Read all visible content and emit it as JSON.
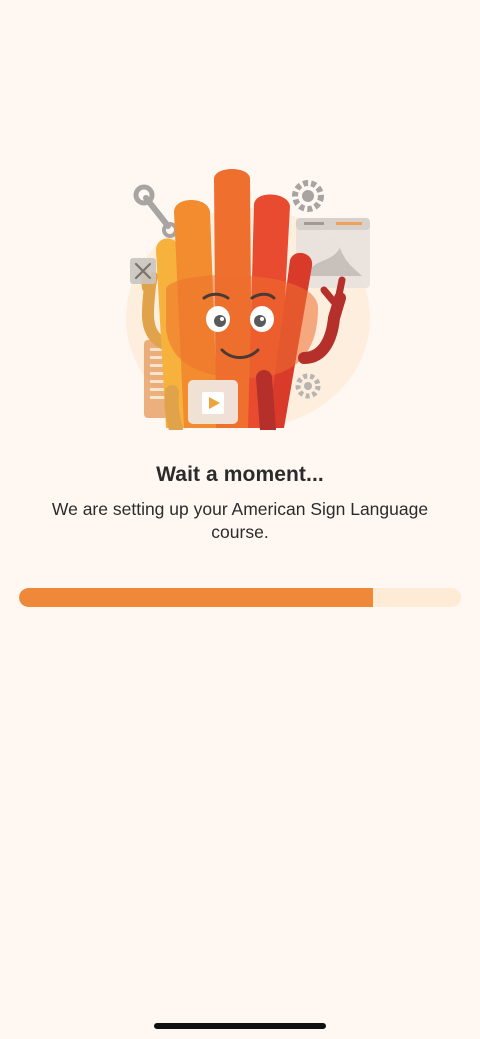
{
  "loading": {
    "title": "Wait a moment...",
    "message": "We are setting up your American Sign Language course.",
    "progress": 0.8
  },
  "colors": {
    "background": "#fff8f2",
    "progress_fill": "#f0883a",
    "progress_track": "#fdebd5",
    "text": "#2b2b2b"
  },
  "icons": [
    "wrench-icon",
    "gear-icon",
    "close-icon",
    "play-icon",
    "browser-window-icon",
    "code-document-icon"
  ]
}
